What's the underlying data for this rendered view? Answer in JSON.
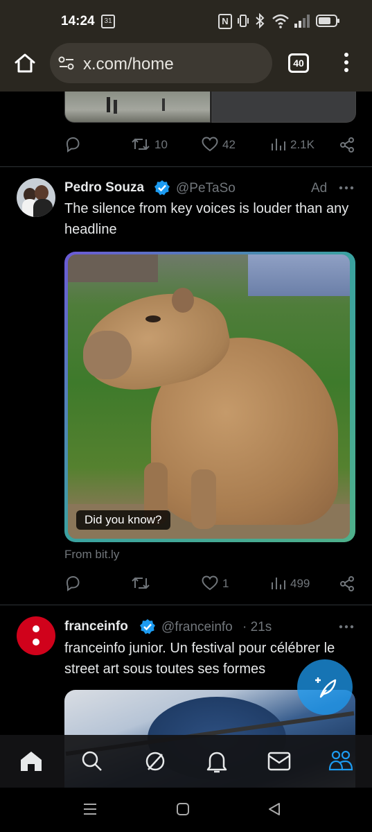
{
  "status_bar": {
    "time": "14:24",
    "calendar_day": "31"
  },
  "browser": {
    "url": "x.com/home",
    "tab_count": "40"
  },
  "prev_tweet": {
    "replies": "",
    "reposts": "10",
    "likes": "42",
    "views": "2.1K"
  },
  "ad_tweet": {
    "name": "Pedro Souza",
    "handle": "@PeTaSo",
    "ad_label": "Ad",
    "text": "The silence from key voices is louder than any headline",
    "card_caption": "Did you know?",
    "source": "From bit.ly",
    "reposts": "",
    "likes": "1",
    "views": "499"
  },
  "news_tweet": {
    "name": "franceinfo",
    "handle": "@franceinfo",
    "time": "· 21s",
    "text": "franceinfo junior. Un festival pour célébrer le street art sous toutes ses formes"
  },
  "colors": {
    "verified": "#1d9bf0",
    "accent": "#1d9bf0",
    "background": "#000000"
  }
}
